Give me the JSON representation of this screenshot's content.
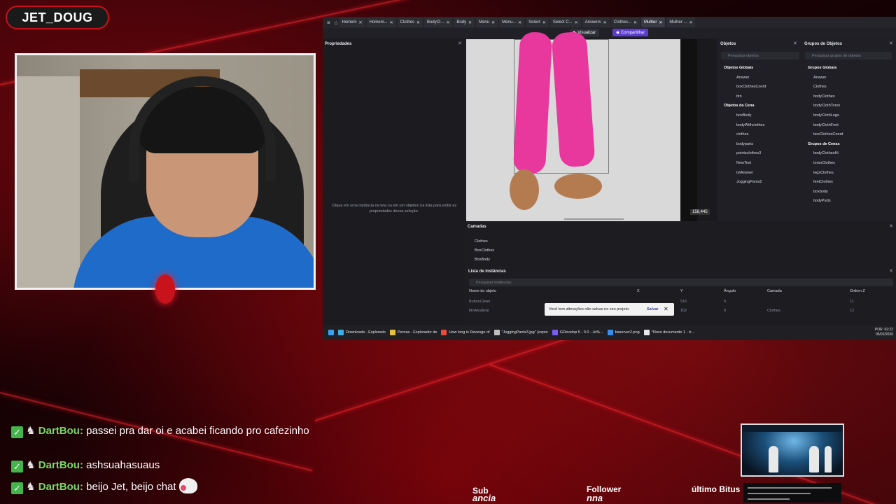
{
  "stream": {
    "streamer_name": "JET_DOUG",
    "accent_color": "#c8121c"
  },
  "app": {
    "tabs": [
      {
        "label": "Homem",
        "active": false
      },
      {
        "label": "Homem...",
        "active": false
      },
      {
        "label": "Clothes",
        "active": false
      },
      {
        "label": "BodyCl...",
        "active": false
      },
      {
        "label": "Body",
        "active": false
      },
      {
        "label": "Menu",
        "active": false
      },
      {
        "label": "Menu...",
        "active": false
      },
      {
        "label": "Select",
        "active": false
      },
      {
        "label": "Select C...",
        "active": false
      },
      {
        "label": "Answers",
        "active": false
      },
      {
        "label": "Clothes...",
        "active": false
      },
      {
        "label": "Mulher",
        "active": true
      },
      {
        "label": "Mulher ...",
        "active": false
      }
    ],
    "preview_label": "Visualizar",
    "share_label": "Compartilhar",
    "properties": {
      "title": "Propriedades",
      "hint": "Clique em uma instância na tela ou em um objetivo na lista para exibir as propriedades dessa seleção."
    },
    "scene": {
      "cursor_coords": "158,445"
    },
    "objects_panel": {
      "title": "Objetos",
      "search_placeholder": "Pesquisar objetos",
      "global_header": "Objetos Globais",
      "global_items": [
        "Answer",
        "boxClothesCoord",
        "btn"
      ],
      "scene_header": "Objetos da Cena",
      "scene_items": [
        "boxBody",
        "bodyWithclothes",
        "clothes",
        "bodyparts",
        "pointsclothes3",
        "NewText",
        "txtAnswer",
        "JoggingPants2"
      ]
    },
    "groups_panel": {
      "title": "Grupos de Objetos",
      "search_placeholder": "Pesquisar grupos de objetos",
      "global_header": "Grupos Globais",
      "global_items": [
        "Answer",
        "Clothes",
        "bodyClothes",
        "bodyClothTorso",
        "bodyClothLegs",
        "bodyClothFeet",
        "boxClothesCoord"
      ],
      "scene_header": "Grupos de Cenas",
      "scene_items": [
        "bodyClothesHi",
        "torsoClothes",
        "legsClothes",
        "feetClothes",
        "boxbody",
        "bodyParts"
      ]
    },
    "layers": {
      "title": "Camadas",
      "items": [
        "Clothes",
        "BoxClothes",
        "BoxBody"
      ]
    },
    "instances": {
      "title": "Lista de instâncias",
      "search_placeholder": "Pesquisar instâncias",
      "columns": [
        "Nome do objeto",
        "X",
        "Y",
        "Ângulo",
        "Camada",
        "Ordem Z"
      ],
      "rows": [
        [
          "ButtonClean",
          "",
          "516",
          "0",
          "",
          "11"
        ],
        [
          "btnAtualizar",
          "",
          "162",
          "0",
          "Clothes",
          "12"
        ]
      ]
    },
    "toast": {
      "message": "Você tem alterações não salvas no seu projeto.",
      "action": "Salvar"
    },
    "taskbar": {
      "items": [
        "Downloads - Explorado",
        "Pernas - Explorador de",
        "How long is Revenge of",
        "\"JoggingPants3.jpg\" (expor",
        "GDevelop 5 - 0.0 - Je%...",
        "baserver2.png",
        "*Novo documento 1 - Ir..."
      ],
      "lang": "POR",
      "time": "02:22",
      "date": "05/02/2026"
    }
  },
  "chat": [
    {
      "user": "DartBou",
      "message": "passei pra dar oi e acabei ficando pro cafezinho",
      "emote": false
    },
    {
      "user": "DartBou",
      "message": "ashsuahasuaus",
      "emote": false
    },
    {
      "user": "DartBou",
      "message": "beijo Jet, beijo chat",
      "emote": true
    }
  ],
  "overlay_stats": {
    "sub_label": "Sub",
    "sub_value": "ancia",
    "follower_label": "Follower",
    "follower_value": "nna",
    "bits_label": "último Bitus"
  }
}
